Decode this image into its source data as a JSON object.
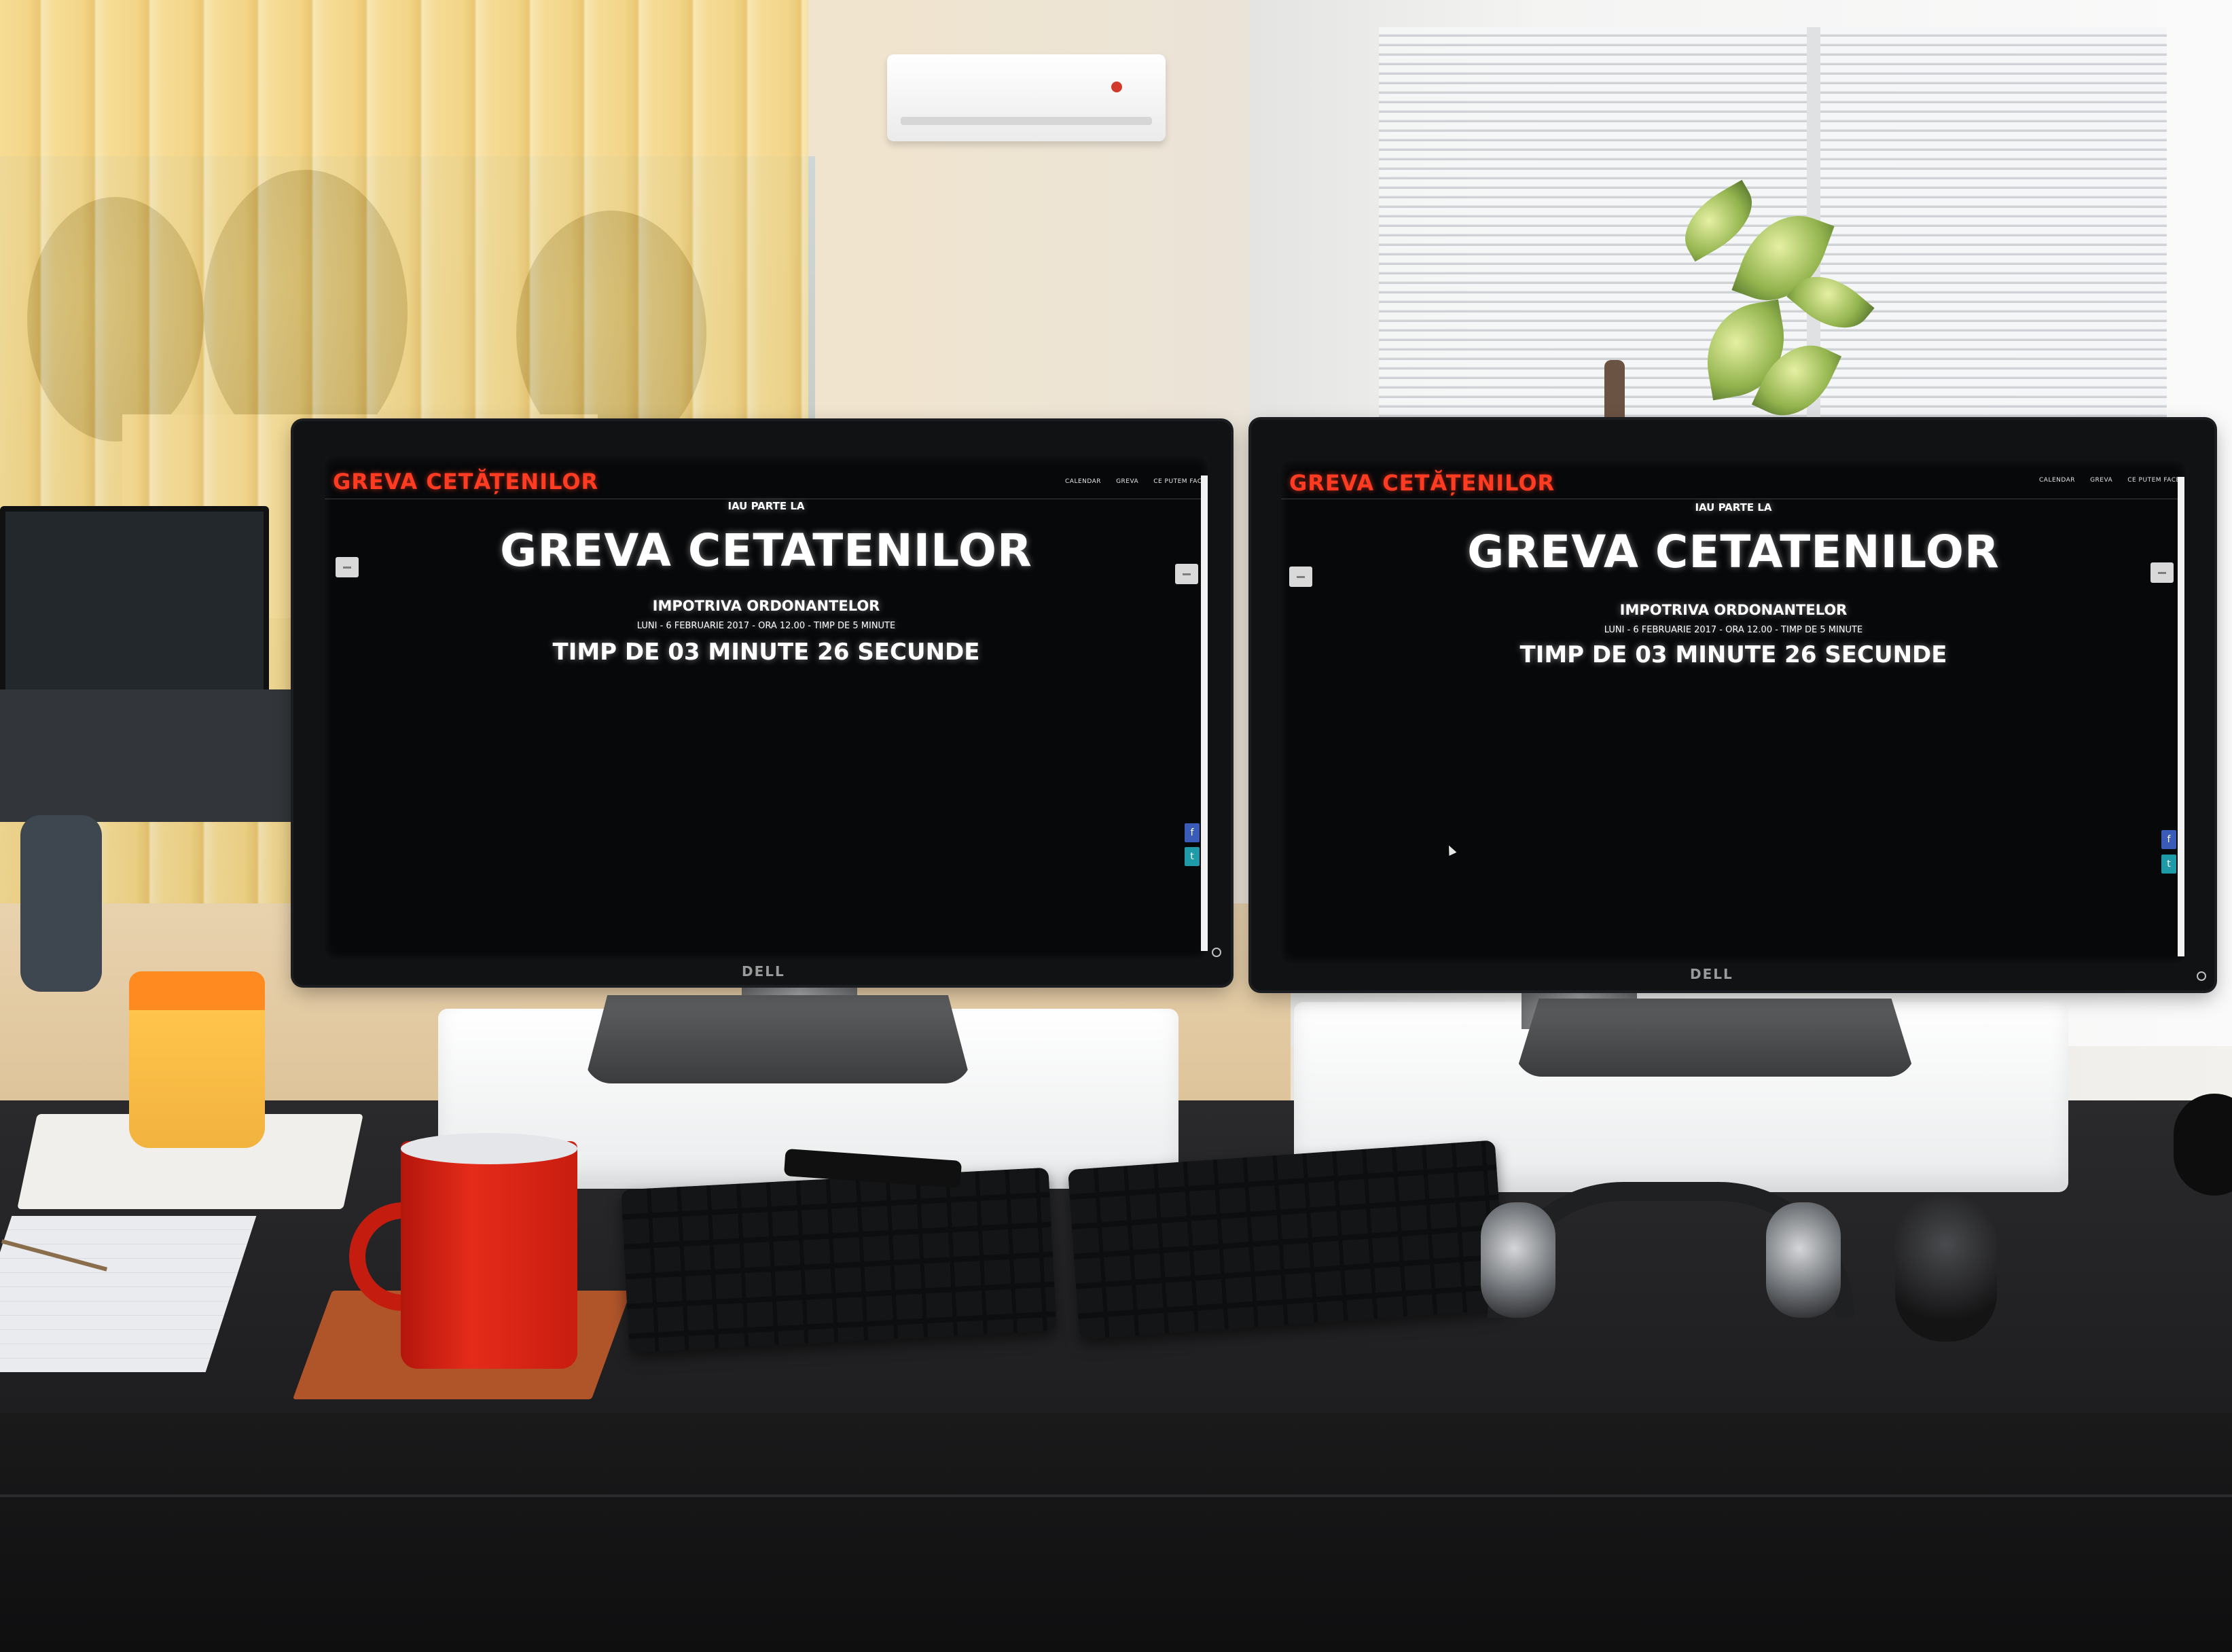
{
  "screens": {
    "left": {
      "logo": "GREVA CETĂȚENILOR",
      "nav": [
        "CALENDAR",
        "GREVA",
        "CE PUTEM FACE"
      ],
      "kicker": "IAU PARTE LA",
      "title": "GREVA CETATENILOR",
      "subtitle": "IMPOTRIVA ORDONANTELOR",
      "details": "LUNI - 6 FEBRUARIE 2017 - ORA 12.00 - TIMP DE 5 MINUTE",
      "countdown": "TIMP DE 03 MINUTE 26 SECUNDE",
      "share": {
        "facebook": "f",
        "twitter": "t"
      }
    },
    "right": {
      "logo": "GREVA CETĂȚENILOR",
      "nav": [
        "CALENDAR",
        "GREVA",
        "CE PUTEM FACE"
      ],
      "kicker": "IAU PARTE LA",
      "title": "GREVA CETATENILOR",
      "subtitle": "IMPOTRIVA ORDONANTELOR",
      "details": "LUNI - 6 FEBRUARIE 2017 - ORA 12.00 - TIMP DE 5 MINUTE",
      "countdown": "TIMP DE 03 MINUTE 26 SECUNDE",
      "share": {
        "facebook": "f",
        "twitter": "t"
      }
    }
  },
  "monitor_brand": "DELL",
  "colors": {
    "logo_red": "#ff3b22",
    "screen_black": "#07080a",
    "facebook_blue": "#3b5bb8",
    "twitter_teal": "#1e9aa8",
    "mug_red": "#e52b1a",
    "cup_orange": "#ff8a1f"
  },
  "icons": [
    "power-icon",
    "cursor-icon",
    "facebook-icon",
    "twitter-icon",
    "minus-icon"
  ]
}
